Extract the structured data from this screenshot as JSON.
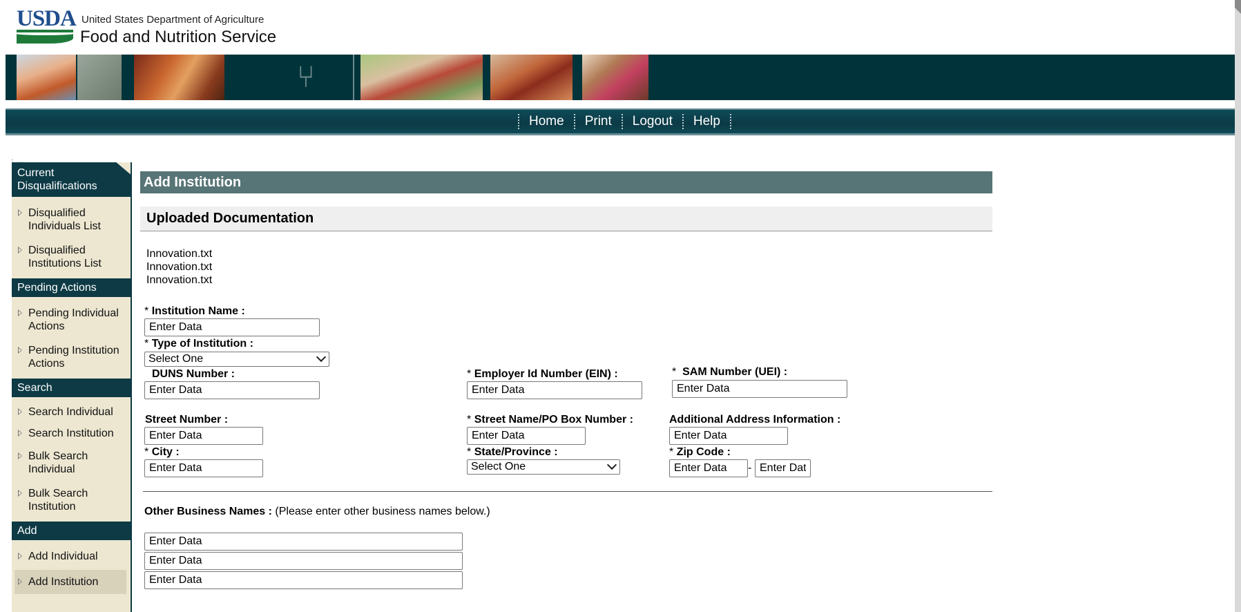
{
  "header": {
    "logo_text": "USDA",
    "agency_line1": "United States Department of Agriculture",
    "agency_line2": "Food and Nutrition Service"
  },
  "nav": {
    "links": [
      "Home",
      "Print",
      "Logout",
      "Help"
    ]
  },
  "sidebar": {
    "sections": [
      {
        "title": "Current Disqualifications",
        "items": [
          "Disqualified Individuals List",
          "Disqualified Institutions List"
        ]
      },
      {
        "title": "Pending Actions",
        "items": [
          "Pending Individual Actions",
          "Pending Institution Actions"
        ]
      },
      {
        "title": "Search",
        "items": [
          "Search Individual",
          "Search Institution",
          "Bulk Search Individual",
          "Bulk Search Institution"
        ]
      },
      {
        "title": "Add",
        "items": [
          "Add Individual",
          "Add Institution"
        ]
      }
    ],
    "active_item": "Add Institution"
  },
  "main": {
    "page_title": "Add Institution",
    "section_title": "Uploaded Documentation",
    "files": [
      "Innovation.txt",
      "Innovation.txt",
      "Innovation.txt"
    ],
    "placeholder": "Enter Data",
    "select_placeholder": "Select One",
    "fields": {
      "institution_name": "Institution Name :",
      "type_of_institution": "Type of Institution :",
      "duns_number": "DUNS Number :",
      "ein": "Employer Id Number (EIN) :",
      "sam_number": "SAM Number (UEI) :",
      "street_number": "Street Number :",
      "street_name": "Street Name/PO Box Number :",
      "additional_address": "Additional Address Information :",
      "city": "City :",
      "state_province": "State/Province :",
      "zip_code": "Zip Code :"
    },
    "zip_ext_value": "Enter Dat",
    "zip_separator": "-",
    "required_marker": "*",
    "other_business_names_label": "Other Business Names :",
    "other_business_names_hint": "(Please enter other business names below.)"
  }
}
